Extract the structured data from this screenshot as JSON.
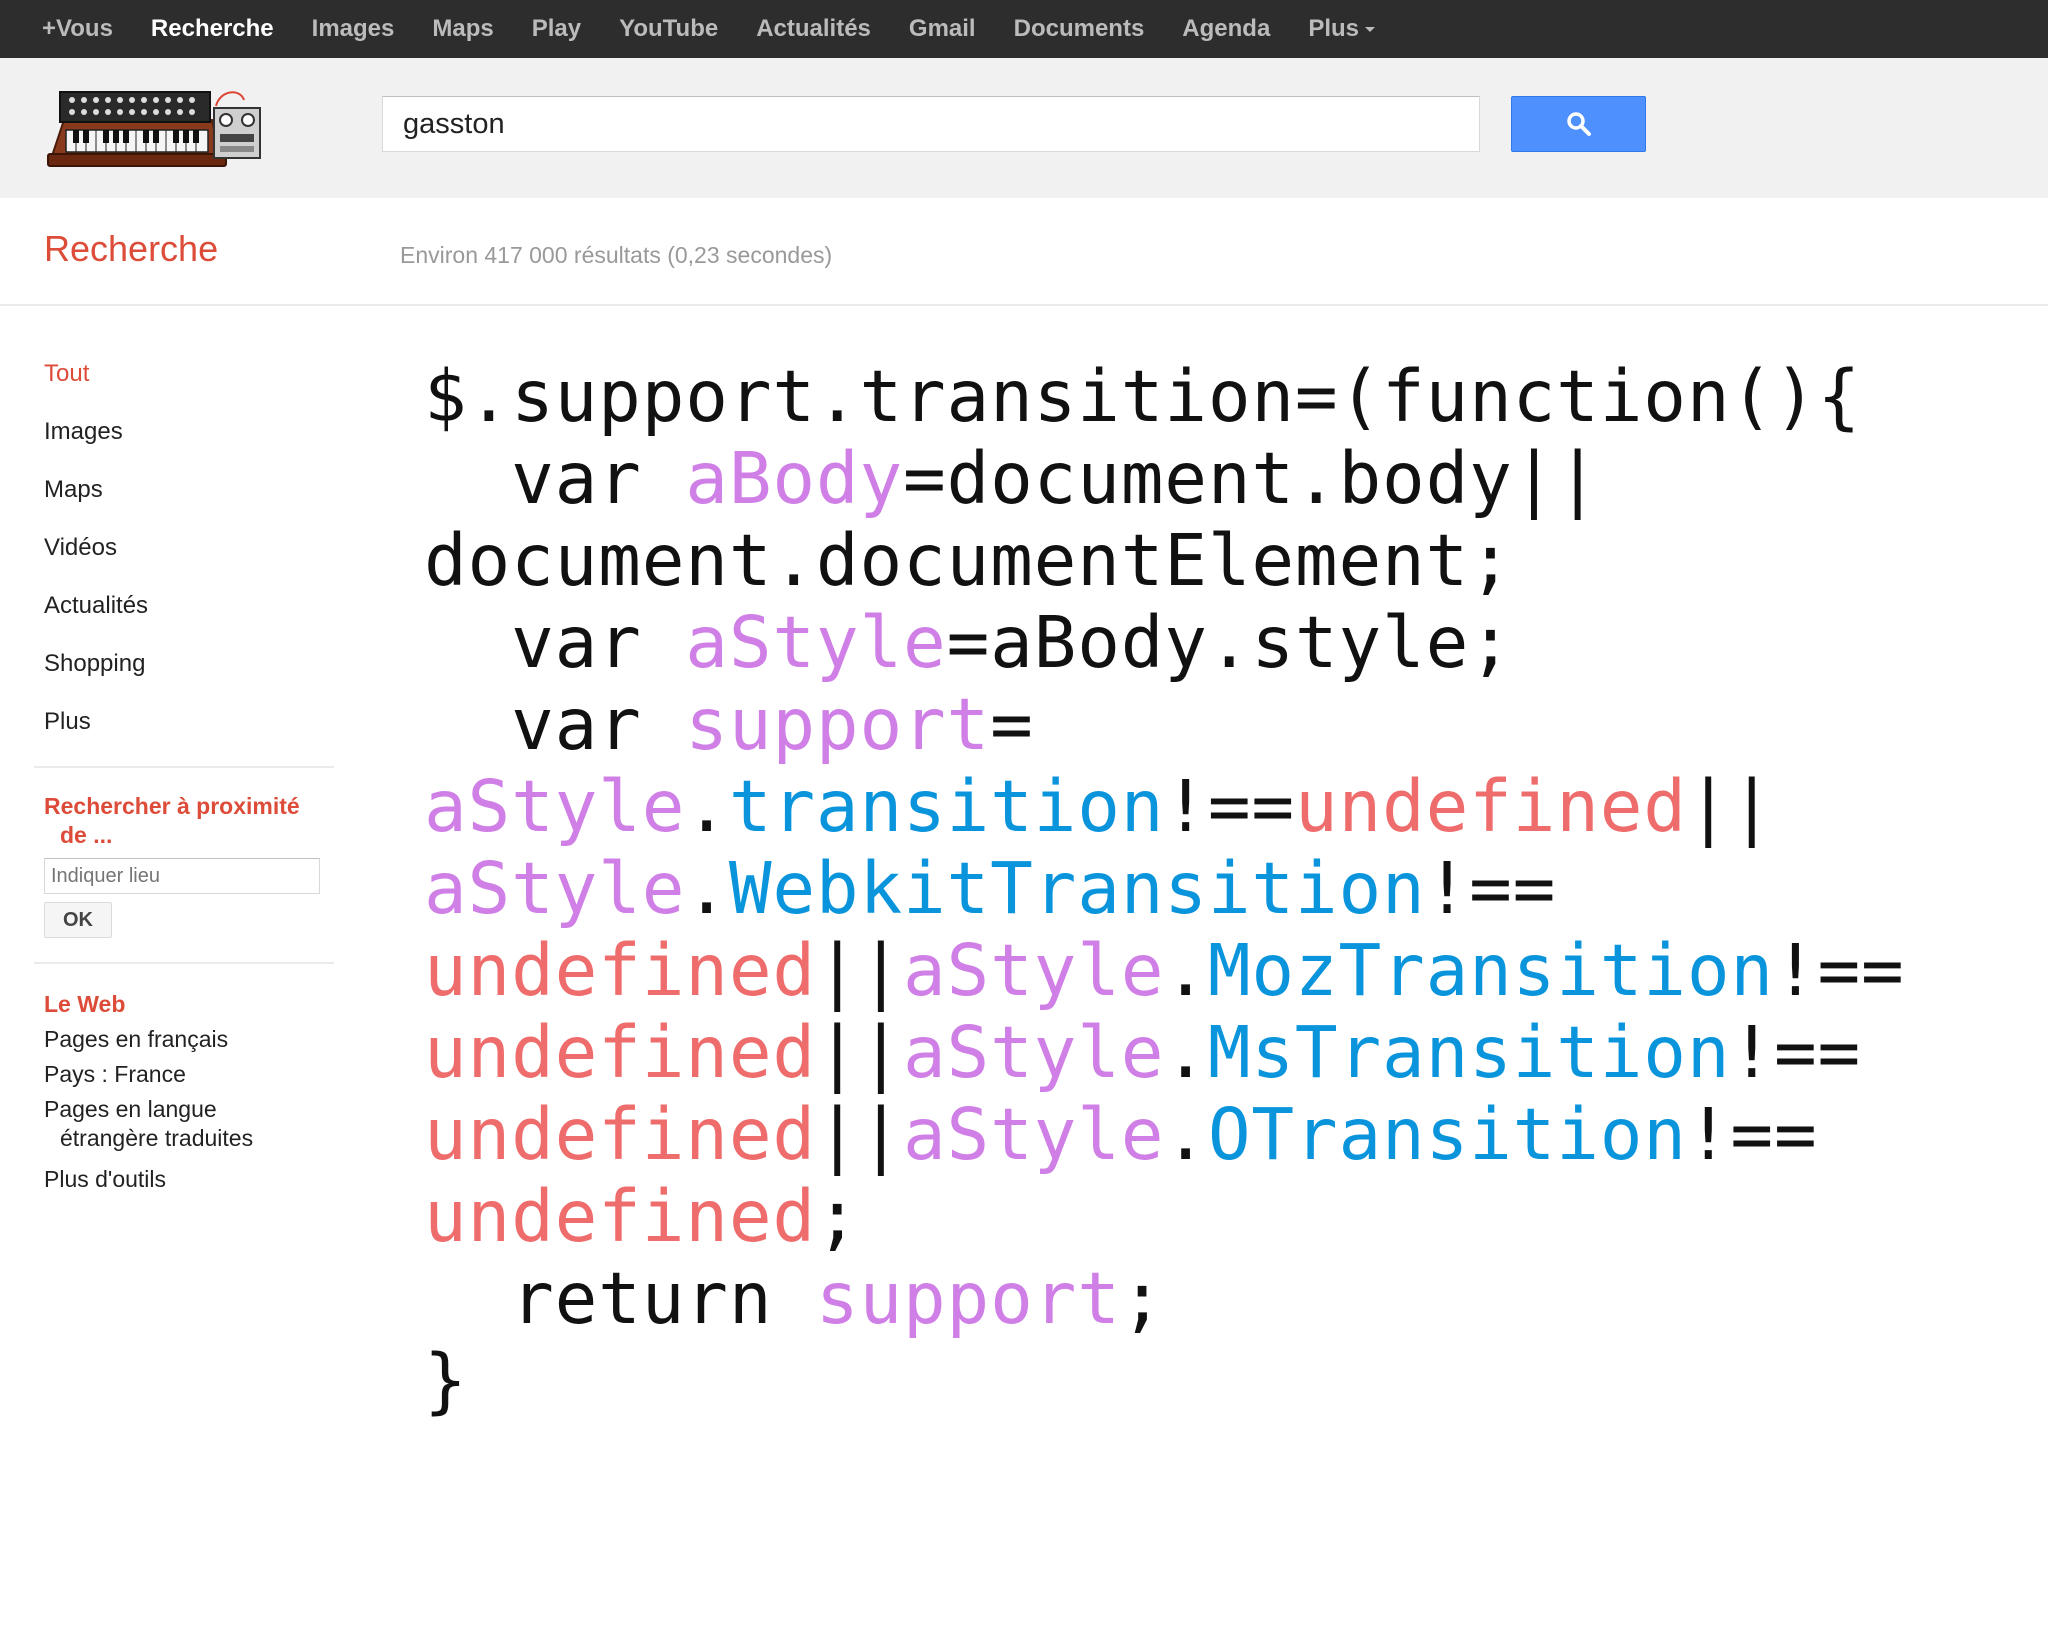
{
  "topbar": {
    "items": [
      {
        "label": "+Vous"
      },
      {
        "label": "Recherche"
      },
      {
        "label": "Images"
      },
      {
        "label": "Maps"
      },
      {
        "label": "Play"
      },
      {
        "label": "YouTube"
      },
      {
        "label": "Actualités"
      },
      {
        "label": "Gmail"
      },
      {
        "label": "Documents"
      },
      {
        "label": "Agenda"
      },
      {
        "label": "Plus"
      }
    ],
    "active": "Recherche"
  },
  "search": {
    "query": "gasston",
    "button_icon": "search-icon",
    "button_color": "#4d90fe"
  },
  "subheader": {
    "title": "Recherche",
    "stats": "Environ 417 000 résultats (0,23 secondes)"
  },
  "sidebar": {
    "nav": [
      {
        "label": "Tout"
      },
      {
        "label": "Images"
      },
      {
        "label": "Maps"
      },
      {
        "label": "Vidéos"
      },
      {
        "label": "Actualités"
      },
      {
        "label": "Shopping"
      },
      {
        "label": "Plus"
      }
    ],
    "nearby": {
      "heading_line1": "Rechercher à proximité",
      "heading_line2": "de ...",
      "placeholder": "Indiquer lieu",
      "ok_label": "OK"
    },
    "web": {
      "heading": "Le Web",
      "pages_fr": "Pages en français",
      "country": "Pays : France",
      "translated_line1": "Pages en langue",
      "translated_line2": "étrangère traduites",
      "more_tools": "Plus d'outils"
    }
  },
  "colors": {
    "accent": "#dd4b39",
    "code_variable": "#cf7fe6",
    "code_property": "#0a94dc",
    "code_undefined": "#ef6c6c"
  },
  "code": {
    "lines": [
      [
        {
          "t": "$.support.transition=(function(){",
          "c": ""
        }
      ],
      [
        {
          "t": "  var ",
          "c": ""
        },
        {
          "t": "aBody",
          "c": "v"
        },
        {
          "t": "=document.body||",
          "c": ""
        }
      ],
      [
        {
          "t": "document.documentElement;",
          "c": ""
        }
      ],
      [
        {
          "t": "  var ",
          "c": ""
        },
        {
          "t": "aStyle",
          "c": "v"
        },
        {
          "t": "=aBody.style;",
          "c": ""
        }
      ],
      [
        {
          "t": "  var ",
          "c": ""
        },
        {
          "t": "support",
          "c": "v"
        },
        {
          "t": "=",
          "c": ""
        }
      ],
      [
        {
          "t": "aStyle",
          "c": "v"
        },
        {
          "t": ".",
          "c": ""
        },
        {
          "t": "transition",
          "c": "p"
        },
        {
          "t": "!==",
          "c": ""
        },
        {
          "t": "undefined",
          "c": "u"
        },
        {
          "t": "||",
          "c": ""
        }
      ],
      [
        {
          "t": "aStyle",
          "c": "v"
        },
        {
          "t": ".",
          "c": ""
        },
        {
          "t": "WebkitTransition",
          "c": "p"
        },
        {
          "t": "!==",
          "c": ""
        }
      ],
      [
        {
          "t": "undefined",
          "c": "u"
        },
        {
          "t": "||",
          "c": ""
        },
        {
          "t": "aStyle",
          "c": "v"
        },
        {
          "t": ".",
          "c": ""
        },
        {
          "t": "MozTransition",
          "c": "p"
        },
        {
          "t": "!==",
          "c": ""
        }
      ],
      [
        {
          "t": "undefined",
          "c": "u"
        },
        {
          "t": "||",
          "c": ""
        },
        {
          "t": "aStyle",
          "c": "v"
        },
        {
          "t": ".",
          "c": ""
        },
        {
          "t": "MsTransition",
          "c": "p"
        },
        {
          "t": "!==",
          "c": ""
        }
      ],
      [
        {
          "t": "undefined",
          "c": "u"
        },
        {
          "t": "||",
          "c": ""
        },
        {
          "t": "aStyle",
          "c": "v"
        },
        {
          "t": ".",
          "c": ""
        },
        {
          "t": "OTransition",
          "c": "p"
        },
        {
          "t": "!==",
          "c": ""
        }
      ],
      [
        {
          "t": "undefined",
          "c": "u"
        },
        {
          "t": ";",
          "c": ""
        }
      ],
      [
        {
          "t": "  return ",
          "c": ""
        },
        {
          "t": "support",
          "c": "v"
        },
        {
          "t": ";",
          "c": ""
        }
      ],
      [
        {
          "t": "}",
          "c": ""
        }
      ]
    ]
  }
}
